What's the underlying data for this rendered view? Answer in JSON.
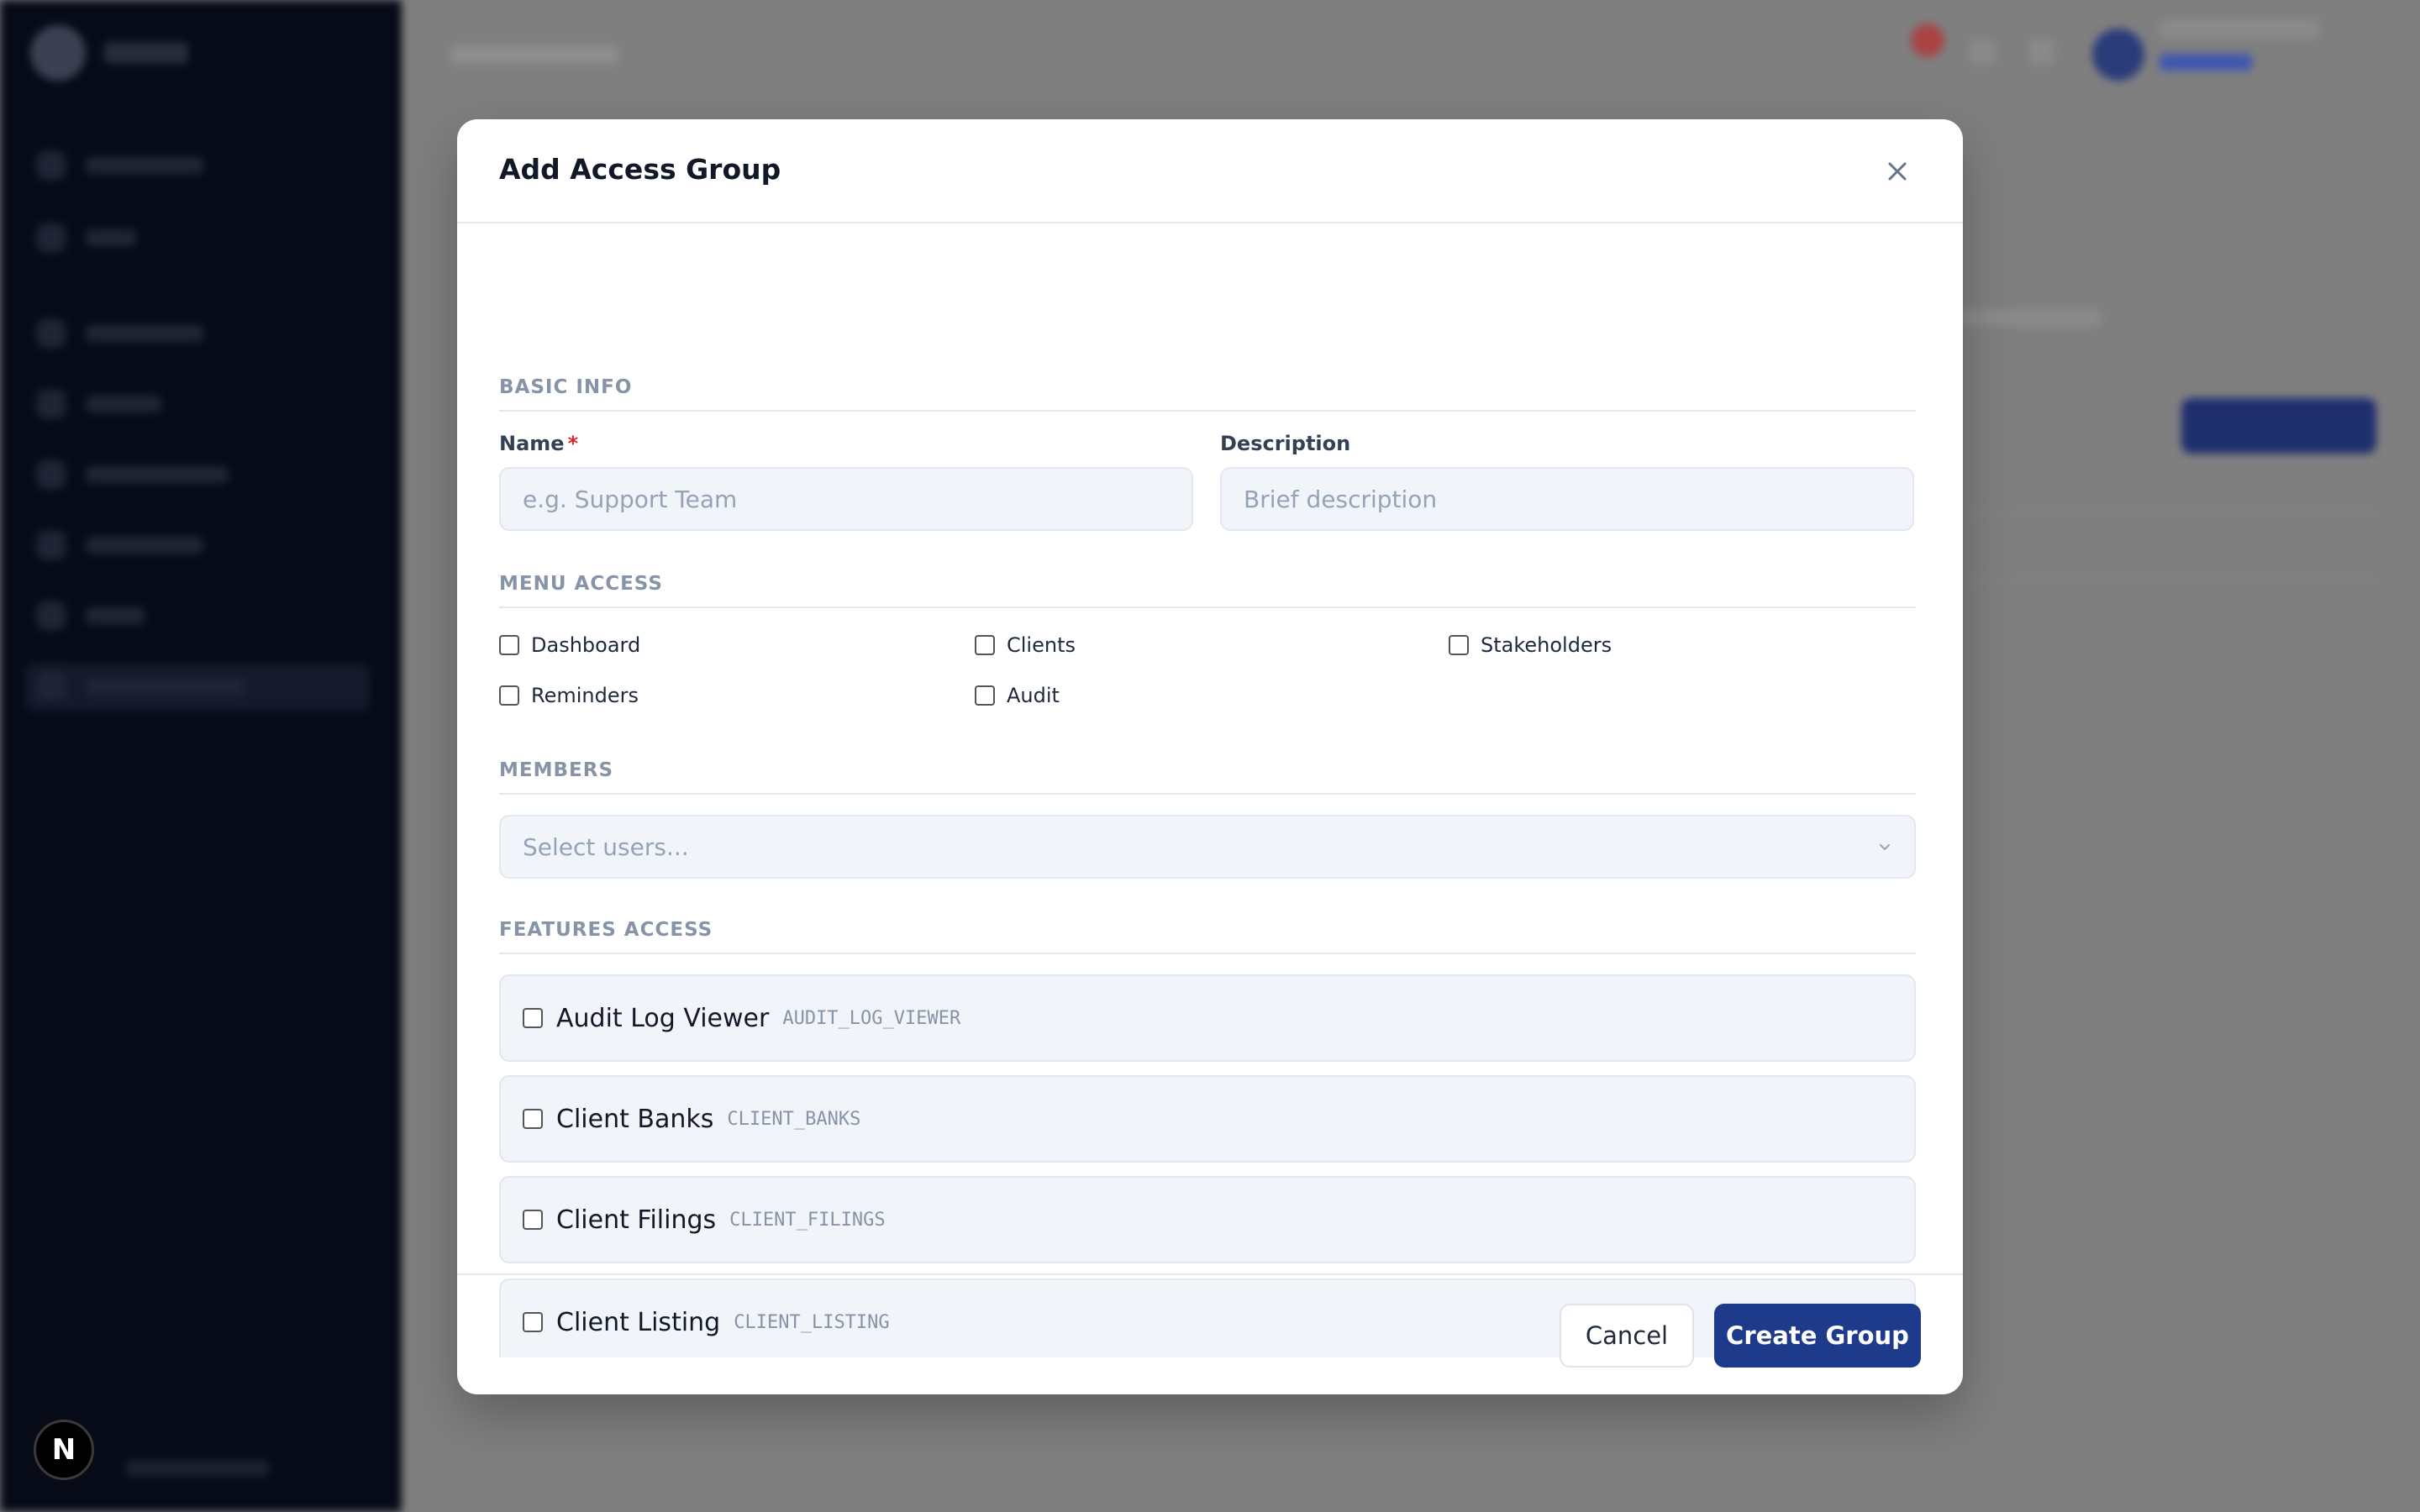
{
  "modal": {
    "title": "Add Access Group",
    "close_icon": "close-icon"
  },
  "basic_info": {
    "section_title": "BASIC INFO",
    "name_label": "Name",
    "name_required_mark": "*",
    "name_placeholder": "e.g. Support Team",
    "name_value": "",
    "description_label": "Description",
    "description_placeholder": "Brief description",
    "description_value": ""
  },
  "menu_access": {
    "section_title": "MENU ACCESS",
    "items": [
      {
        "label": "Dashboard",
        "checked": false
      },
      {
        "label": "Clients",
        "checked": false
      },
      {
        "label": "Stakeholders",
        "checked": false
      },
      {
        "label": "Reminders",
        "checked": false
      },
      {
        "label": "Audit",
        "checked": false
      }
    ]
  },
  "members": {
    "section_title": "MEMBERS",
    "placeholder": "Select users...",
    "chevron_icon": "chevron-down-icon"
  },
  "features_access": {
    "section_title": "FEATURES ACCESS",
    "items": [
      {
        "name": "Audit Log Viewer",
        "code": "AUDIT_LOG_VIEWER",
        "checked": false
      },
      {
        "name": "Client Banks",
        "code": "CLIENT_BANKS",
        "checked": false
      },
      {
        "name": "Client Filings",
        "code": "CLIENT_FILINGS",
        "checked": false
      },
      {
        "name": "Client Listing",
        "code": "CLIENT_LISTING",
        "checked": false
      }
    ]
  },
  "footer": {
    "cancel_label": "Cancel",
    "create_label": "Create Group"
  },
  "badge": {
    "letter": "N"
  },
  "colors": {
    "primary": "#1e3a8a",
    "required": "#dc2626",
    "section_title": "#8793a6",
    "sidebar_bg": "#070b18"
  }
}
